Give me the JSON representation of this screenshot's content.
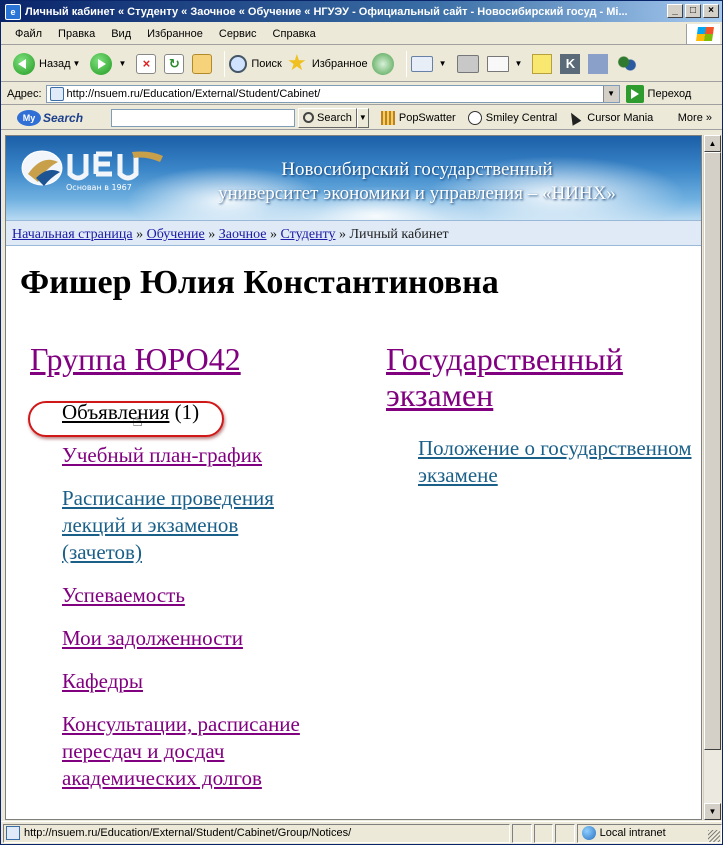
{
  "window": {
    "title": "Личный кабинет « Студенту « Заочное « Обучение « НГУЭУ - Официальный сайт - Новосибирский госуд - Mi..."
  },
  "menu": [
    "Файл",
    "Правка",
    "Вид",
    "Избранное",
    "Сервис",
    "Справка"
  ],
  "toolbar": {
    "back": "Назад",
    "search": "Поиск",
    "favorites": "Избранное"
  },
  "address": {
    "label": "Адрес:",
    "url": "http://nsuem.ru/Education/External/Student/Cabinet/",
    "go": "Переход"
  },
  "searchbar": {
    "logo": "Search",
    "logo_prefix": "My",
    "search_button": "Search",
    "items": [
      "PopSwatter",
      "Smiley Central",
      "Cursor Mania"
    ],
    "more": "More"
  },
  "banner": {
    "logo_caption": "Основан в 1967",
    "title_line1": "Новосибирский государственный",
    "title_line2": "университет экономики и управления – «НИНХ»"
  },
  "breadcrumb": {
    "items": [
      "Начальная страница",
      "Обучение",
      "Заочное",
      "Студенту"
    ],
    "separator": "»",
    "current": "Личный кабинет"
  },
  "page": {
    "title": "Фишер Юлия Константиновна"
  },
  "left": {
    "heading": "Группа ЮРО42",
    "announce_label": "Объявления",
    "announce_count": "(1)",
    "links": [
      "Учебный план-график",
      "Расписание проведения лекций и экзаменов (зачетов)",
      "Успеваемость",
      "Мои задолженности",
      "Кафедры",
      "Консультации, расписание пересдач и досдач академических долгов"
    ]
  },
  "right": {
    "heading": "Государственный экзамен",
    "links": [
      "Положение о государственном экзамене"
    ]
  },
  "status": {
    "url": "http://nsuem.ru/Education/External/Student/Cabinet/Group/Notices/",
    "zone": "Local intranet"
  }
}
